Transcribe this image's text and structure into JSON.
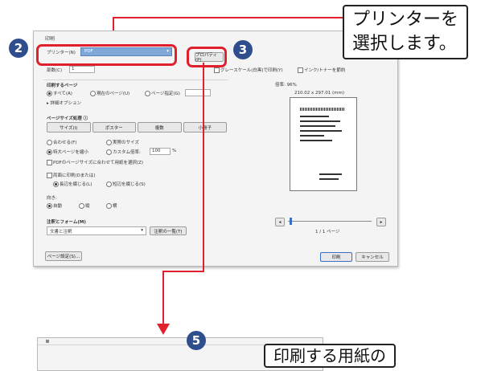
{
  "dialog": {
    "title": "印刷",
    "printer_label": "プリンター(N)",
    "printer_value": "PDF",
    "copies_label": "部数(C)",
    "copies_value": "1",
    "properties_button": "プロパティ(P)",
    "grayscale_label": "グレースケール(白黒)で印刷(Y)",
    "ink_label": "インク/トナーを節約",
    "pages_section": "印刷するページ",
    "radio_all": "すべて(A)",
    "radio_current": "現在のページ(U)",
    "radio_pages": "ページ指定(G)",
    "more_options": "▸ 詳細オプション",
    "sizing_section": "ページサイズ処理 ⓘ",
    "sizing_buttons": [
      "サイズ(I)",
      "ポスター",
      "複数",
      "小冊子"
    ],
    "fit_label": "合わせる(F)",
    "actual_size_label": "実際のサイズ",
    "shrink_label": "特大ページを縮小",
    "custom_scale_label": "カスタム倍率:",
    "custom_scale_value": "100",
    "percent": "%",
    "paper_source_label": "PDFのページサイズに合わせて用紙を選択(Z)",
    "duplex_label": "両面に印刷(Dまたは)",
    "duplex_long": "長辺を綴じる(L)",
    "duplex_short": "短辺を綴じる(S)",
    "orientation_label": "向き:",
    "orient_auto": "自動",
    "orient_portrait": "縦",
    "orient_landscape": "横",
    "comments_section": "注釈とフォーム(M)",
    "comments_value": "文書と注釈",
    "comments_summary_button": "注釈の一覧(T)",
    "preview_scale": "倍率: 96%",
    "preview_dims": "210.02 x 297.01 (mm)",
    "page_counter": "1 / 1 ページ",
    "page_setup_button": "ページ設定(S)...",
    "print_button": "印刷",
    "cancel_button": "キャンセル"
  },
  "annotations": {
    "badge2": "2",
    "badge3": "3",
    "badge5": "5",
    "callout_top": [
      "プリンターを",
      "選択します。"
    ],
    "callout_bottom": "印刷する用紙の"
  },
  "colors": {
    "highlight": "#e0202c",
    "badge": "#2f4e8d",
    "printer_field": "#7fa8d9"
  }
}
